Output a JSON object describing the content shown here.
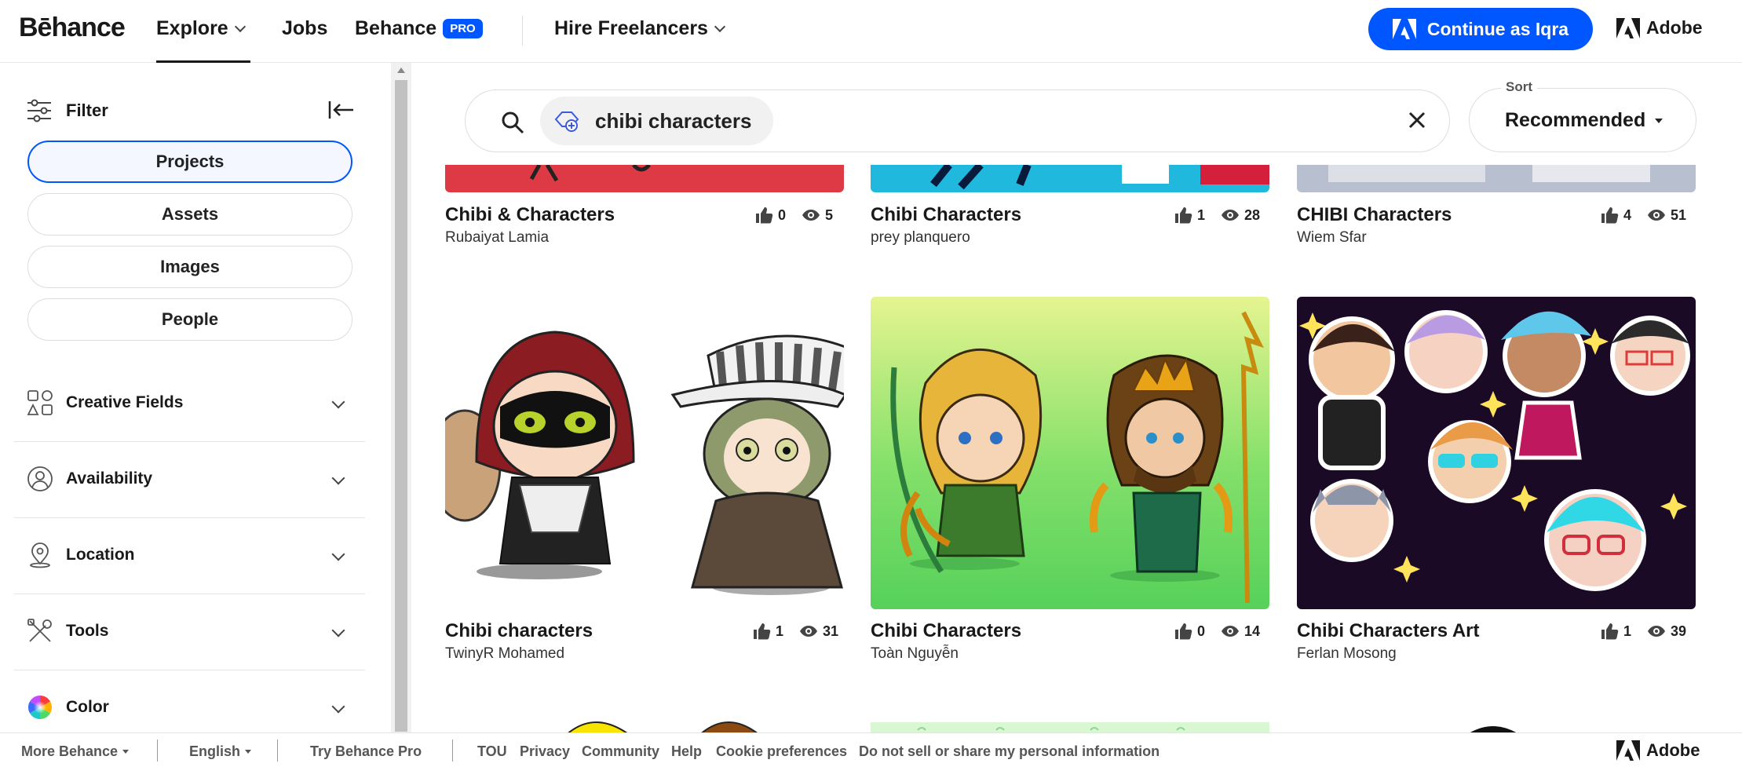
{
  "nav": {
    "logo": "Bēhance",
    "explore": "Explore",
    "jobs": "Jobs",
    "behance": "Behance",
    "pro_badge": "PRO",
    "hire": "Hire Freelancers",
    "continue": "Continue as Iqra",
    "adobe": "Adobe"
  },
  "sidebar": {
    "filter_label": "Filter",
    "types": [
      {
        "label": "Projects",
        "active": true
      },
      {
        "label": "Assets",
        "active": false
      },
      {
        "label": "Images",
        "active": false
      },
      {
        "label": "People",
        "active": false
      }
    ],
    "facets": [
      {
        "label": "Creative Fields",
        "icon": "shapes-icon"
      },
      {
        "label": "Availability",
        "icon": "person-circle-icon"
      },
      {
        "label": "Location",
        "icon": "location-pin-icon"
      },
      {
        "label": "Tools",
        "icon": "tools-icon"
      },
      {
        "label": "Color",
        "icon": "color-wheel-icon"
      }
    ]
  },
  "search": {
    "query": "chibi characters",
    "sort_label": "Sort",
    "sort_value": "Recommended"
  },
  "projects_row1": [
    {
      "title": "Chibi & Characters",
      "owner": "Rubaiyat Lamia",
      "likes": "0",
      "views": "5"
    },
    {
      "title": "Chibi Characters",
      "owner": "prey planquero",
      "likes": "1",
      "views": "28"
    },
    {
      "title": "CHIBI Characters",
      "owner": "Wiem Sfar",
      "likes": "4",
      "views": "51"
    }
  ],
  "projects_row2": [
    {
      "title": "Chibi characters",
      "owner": "TwinyR Mohamed",
      "likes": "1",
      "views": "31"
    },
    {
      "title": "Chibi Characters",
      "owner": "Toàn Nguyễn",
      "likes": "0",
      "views": "14"
    },
    {
      "title": "Chibi Characters Art",
      "owner": "Ferlan Mosong",
      "likes": "1",
      "views": "39"
    }
  ],
  "footer": {
    "more": "More Behance",
    "language": "English",
    "try_pro": "Try Behance Pro",
    "tou": "TOU",
    "privacy": "Privacy",
    "community": "Community",
    "help": "Help",
    "cookies": "Cookie preferences",
    "dns": "Do not sell or share my personal information",
    "adobe": "Adobe"
  },
  "colors": {
    "accent": "#0057ff",
    "text": "#191919"
  }
}
